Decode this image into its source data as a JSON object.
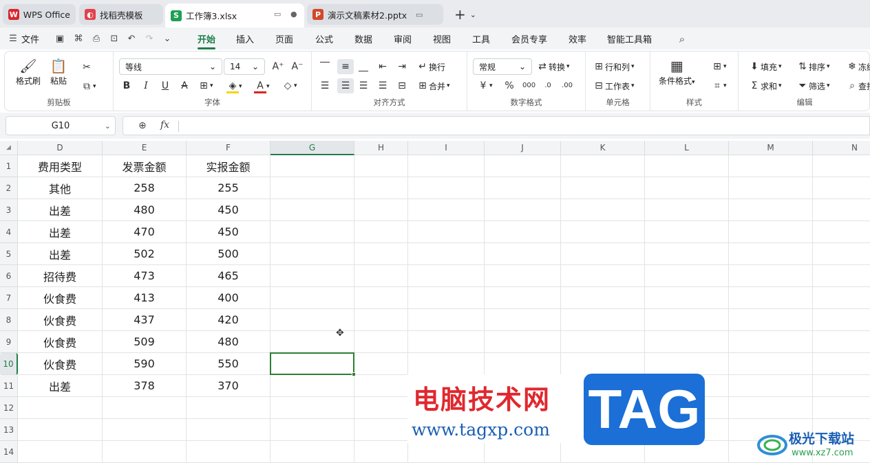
{
  "tabs": [
    {
      "label": "WPS Office",
      "logo": "W",
      "color": "#d9262c"
    },
    {
      "label": "找稻壳模板",
      "logo": "◐",
      "color": "#e3414b"
    },
    {
      "label": "工作簿3.xlsx",
      "logo": "S",
      "color": "#1e9f56"
    },
    {
      "label": "演示文稿素材2.pptx",
      "logo": "P",
      "color": "#d2482a"
    }
  ],
  "menu": {
    "file_label": "文件",
    "items": [
      "开始",
      "插入",
      "页面",
      "公式",
      "数据",
      "审阅",
      "视图",
      "工具",
      "会员专享",
      "效率",
      "智能工具箱"
    ],
    "active": "开始"
  },
  "ribbon": {
    "clipboard": {
      "format_painter": "格式刷",
      "paste": "粘贴",
      "label": "剪贴板"
    },
    "font": {
      "name": "等线",
      "size": "14",
      "label": "字体"
    },
    "align": {
      "wrap": "换行",
      "merge": "合并",
      "label": "对齐方式"
    },
    "number": {
      "format": "常规",
      "convert": "转换",
      "label": "数字格式"
    },
    "cells": {
      "rowcol": "行和列",
      "sheet": "工作表",
      "label": "单元格"
    },
    "style": {
      "cond": "条件格式",
      "label": "样式"
    },
    "edit": {
      "fill": "填充",
      "sort": "排序",
      "freeze": "冻结",
      "sum": "求和",
      "filter": "筛选",
      "find": "查找",
      "label": "编辑"
    }
  },
  "formula_bar": {
    "name_box": "G10",
    "fx": "fx",
    "formula": ""
  },
  "columns": [
    "D",
    "E",
    "F",
    "G",
    "H",
    "I",
    "J",
    "K",
    "L",
    "M",
    "N"
  ],
  "selected_column": "G",
  "rows": [
    "1",
    "2",
    "3",
    "4",
    "5",
    "6",
    "7",
    "8",
    "9",
    "10",
    "11",
    "12",
    "13",
    "14"
  ],
  "selected_row": "10",
  "table": [
    [
      "费用类型",
      "发票金额",
      "实报金额"
    ],
    [
      "其他",
      "258",
      "255"
    ],
    [
      "出差",
      "480",
      "450"
    ],
    [
      "出差",
      "470",
      "450"
    ],
    [
      "出差",
      "502",
      "500"
    ],
    [
      "招待费",
      "473",
      "465"
    ],
    [
      "伙食费",
      "413",
      "400"
    ],
    [
      "伙食费",
      "437",
      "420"
    ],
    [
      "伙食费",
      "509",
      "480"
    ],
    [
      "伙食费",
      "590",
      "550"
    ],
    [
      "出差",
      "378",
      "370"
    ]
  ],
  "watermark": {
    "site_cn": "电脑技术网",
    "site_url": "www.tagxp.com",
    "tag": "TAG",
    "brand_cn": "极光下载站",
    "brand_url": "www.xz7.com"
  }
}
